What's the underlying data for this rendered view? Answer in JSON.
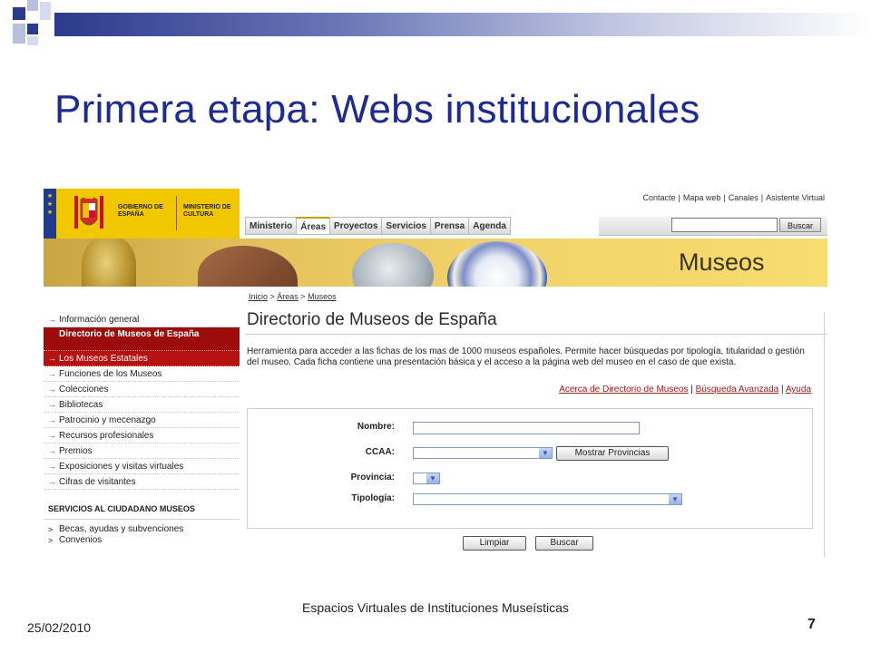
{
  "slide": {
    "title": "Primera etapa: Webs institucionales",
    "footer_date": "25/02/2010",
    "footer_center": "Espacios Virtuales de Instituciones Museísticas",
    "page_number": "7",
    "colors": {
      "title": "#1c2a92",
      "deco_dark": "#2c3a8c",
      "deco_light": "#b9c0df"
    }
  },
  "site": {
    "logo": {
      "gobierno": "GOBIERNO DE ESPAÑA",
      "ministerio": "MINISTERIO DE CULTURA"
    },
    "top_links": [
      "Contacte",
      "Mapa web",
      "Canales",
      "Asistente Virtual"
    ],
    "nav_tabs": [
      {
        "label": "Ministerio",
        "active": false
      },
      {
        "label": "Áreas",
        "active": true
      },
      {
        "label": "Proyectos",
        "active": false
      },
      {
        "label": "Servicios",
        "active": false
      },
      {
        "label": "Prensa",
        "active": false
      },
      {
        "label": "Agenda",
        "active": false
      }
    ],
    "search_button": "Buscar",
    "banner_label": "Museos",
    "breadcrumb": [
      "Inicio",
      "Áreas",
      "Museos"
    ],
    "sidebar": {
      "items": [
        {
          "label": "Información general"
        },
        {
          "label": "Directorio de Museos de España"
        },
        {
          "label": "Los Museos Estatales"
        },
        {
          "label": "Funciones de los Museos"
        },
        {
          "label": "Colecciones"
        },
        {
          "label": "Bibliotecas"
        },
        {
          "label": "Patrocinio y mecenazgo"
        },
        {
          "label": "Recursos profesionales"
        },
        {
          "label": "Premios"
        },
        {
          "label": "Exposiciones y visitas virtuales"
        },
        {
          "label": "Cifras de visitantes"
        }
      ],
      "section_title": "SERVICIOS AL CIUDADANO MUSEOS",
      "sub_items": [
        {
          "label": "Becas, ayudas y subvenciones"
        },
        {
          "label": "Convenios"
        }
      ]
    },
    "main": {
      "heading": "Directorio de Museos de España",
      "description": "Herramienta para acceder a las fichas de los mas de 1000 museos españoles. Permite hacer búsquedas por tipología, titularidad o gestión del museo. Cada ficha contiene una presentación básica y el acceso a la página web del museo en el caso de que exista.",
      "links": [
        "Acerca de Directorio de Museos",
        "Búsqueda Avanzada",
        "Ayuda"
      ],
      "form": {
        "nombre_label": "Nombre:",
        "nombre_value": "",
        "ccaa_label": "CCAA:",
        "ccaa_value": "",
        "mostrar_button": "Mostrar Provincias",
        "provincia_label": "Provincia:",
        "provincia_value": "",
        "tipologia_label": "Tipología:",
        "tipologia_value": "",
        "limpiar_button": "Limpiar",
        "buscar_button": "Buscar"
      }
    }
  }
}
